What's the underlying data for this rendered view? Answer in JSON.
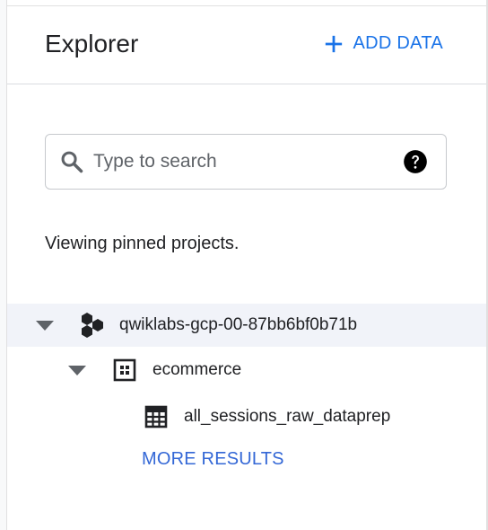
{
  "explorer": {
    "title": "Explorer",
    "add_data_label": "ADD DATA"
  },
  "search": {
    "placeholder": "Type to search"
  },
  "status_text": "Viewing pinned projects.",
  "tree": {
    "project": "qwiklabs-gcp-00-87bb6bf0b71b",
    "dataset": "ecommerce",
    "table": "all_sessions_raw_dataprep"
  },
  "more_results_label": "MORE RESULTS",
  "colors": {
    "accent": "#1a73e8",
    "selected_row": "#f1f3f9"
  },
  "icons": [
    "plus-icon",
    "search-icon",
    "help-icon",
    "caret-down-icon",
    "project-icon",
    "dataset-icon",
    "table-icon"
  ]
}
